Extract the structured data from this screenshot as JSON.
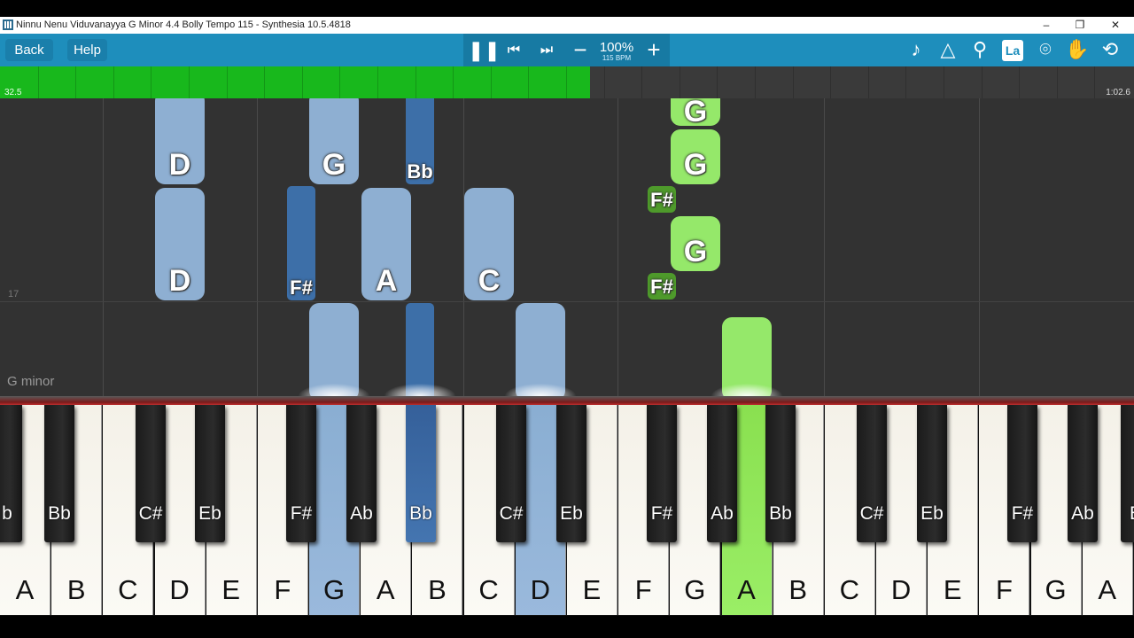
{
  "window": {
    "title": "Ninnu Nenu Viduvanayya G Minor 4.4 Bolly Tempo 115 - Synthesia 10.5.4818",
    "controls": [
      "–",
      "❐",
      "✕"
    ]
  },
  "toolbar": {
    "back_label": "Back",
    "help_label": "Help",
    "zoom": "100%",
    "bpm": "115 BPM",
    "label_mode": "La",
    "icons": [
      "pause-icon",
      "skip-back-icon",
      "skip-forward-icon",
      "minus-icon",
      "plus-icon",
      "note-icon",
      "metronome-icon",
      "magnifier-icon",
      "label-icon",
      "location-pin-icon",
      "hand-icon",
      "loop-icon"
    ]
  },
  "progress": {
    "fraction": 0.52,
    "time_left": "32.5",
    "time_right": "1:02.6"
  },
  "field": {
    "measure_number": "17",
    "key_signature": "G minor"
  },
  "notes": [
    "D",
    "D",
    "G",
    "G",
    "Bb",
    "F#",
    "A",
    "C",
    "G",
    "G",
    "F#",
    "G",
    "F#"
  ],
  "keyboard": {
    "white_keys": [
      "A",
      "B",
      "C",
      "D",
      "E",
      "F",
      "G",
      "A",
      "B",
      "C",
      "D",
      "E",
      "F",
      "G",
      "A",
      "B",
      "C",
      "D",
      "E",
      "F",
      "G",
      "A"
    ],
    "black_keys": [
      "b",
      "Bb",
      "C#",
      "Eb",
      "F#",
      "Ab",
      "Bb",
      "C#",
      "Eb",
      "F#",
      "Ab",
      "Bb",
      "C#",
      "Eb",
      "F#",
      "Ab",
      "E"
    ]
  },
  "colors": {
    "toolbar": "#1e8ebc",
    "progress_fill": "#18b81c",
    "left_hand_note": "#8eafd2",
    "left_hand_sharp": "#3d6fa8",
    "right_hand_note": "#95e86a",
    "right_hand_sharp": "#4e9a2b"
  }
}
